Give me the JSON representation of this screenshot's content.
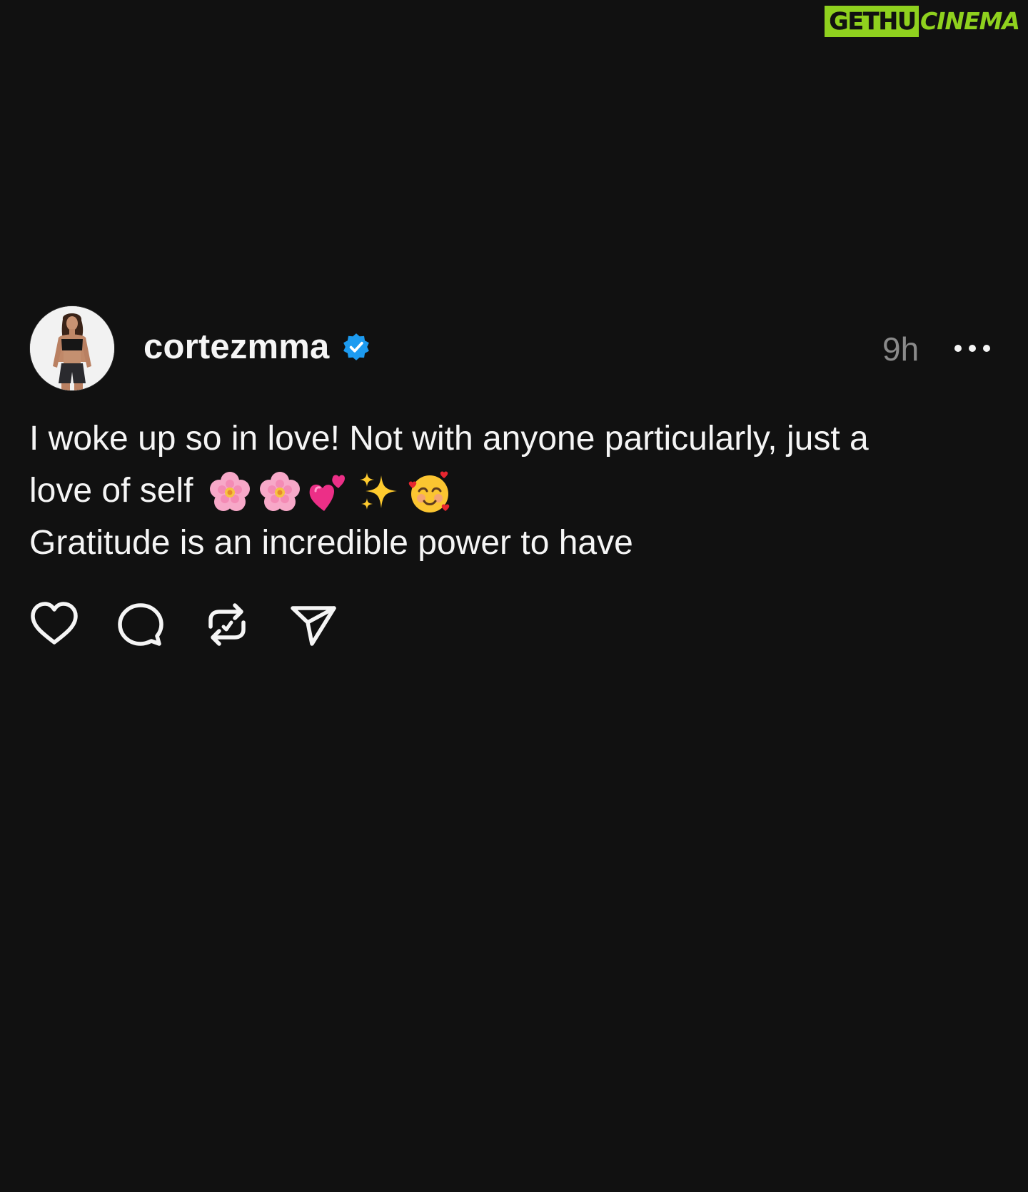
{
  "watermark": {
    "left_text": "GETHU",
    "right_text": "CINEMA"
  },
  "post": {
    "username": "cortezmma",
    "verified": true,
    "timestamp": "9h",
    "text_line1": "I woke up so in love! Not with anyone particularly, just a",
    "text_line2": "love of self",
    "text_line3": "Gratitude is an incredible power to have",
    "emojis": [
      "cherry-blossom",
      "cherry-blossom",
      "two-hearts",
      "sparkles",
      "smiling-face-with-hearts"
    ]
  },
  "actions": [
    "like",
    "comment",
    "repost",
    "share"
  ],
  "colors": {
    "background": "#111111",
    "text": "#f5f5f5",
    "muted": "#8a8a8a",
    "verified_blue": "#1d9bf0",
    "watermark_green": "#8fd11e"
  }
}
